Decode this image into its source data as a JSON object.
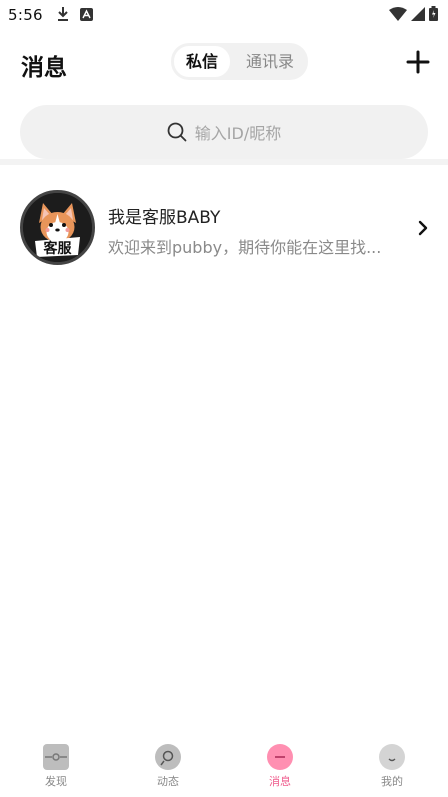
{
  "status_bar": {
    "time": "5:56"
  },
  "header": {
    "title": "消息",
    "tabs": [
      {
        "label": "私信",
        "active": true
      },
      {
        "label": "通讯录",
        "active": false
      }
    ],
    "add_icon": "plus-icon"
  },
  "search": {
    "placeholder": "输入ID/昵称",
    "icon": "search-icon"
  },
  "conversations": [
    {
      "name": "我是客服BABY",
      "preview": "欢迎来到pubby，期待你能在这里找...",
      "avatar_text": "客服"
    }
  ],
  "bottom_nav": {
    "items": [
      {
        "label": "发现",
        "icon": "discover-icon",
        "active": false
      },
      {
        "label": "动态",
        "icon": "moments-icon",
        "active": false
      },
      {
        "label": "消息",
        "icon": "message-icon",
        "active": true
      },
      {
        "label": "我的",
        "icon": "profile-icon",
        "active": false
      }
    ]
  },
  "colors": {
    "accent": "#ef5b8c",
    "muted": "#888888",
    "surface": "#f1f1f1"
  }
}
